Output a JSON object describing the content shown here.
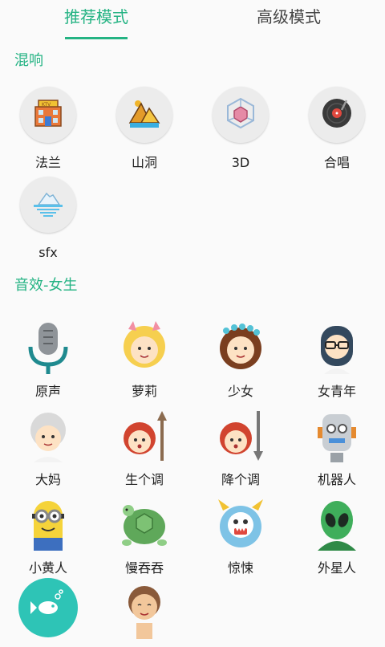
{
  "tabs": {
    "recommended": "推荐模式",
    "advanced": "高级模式"
  },
  "sections": {
    "mix_title": "混响",
    "female_title": "音效-女生"
  },
  "mix_items": [
    {
      "label": "法兰",
      "icon": "ktv-building-icon"
    },
    {
      "label": "山洞",
      "icon": "mountain-cave-icon"
    },
    {
      "label": "3D",
      "icon": "3d-cube-icon"
    },
    {
      "label": "合唱",
      "icon": "vinyl-record-icon"
    },
    {
      "label": "sfx",
      "icon": "iceberg-icon"
    }
  ],
  "female_items": [
    {
      "label": "原声",
      "icon": "microphone-icon"
    },
    {
      "label": "萝莉",
      "icon": "loli-girl-icon"
    },
    {
      "label": "少女",
      "icon": "young-girl-icon"
    },
    {
      "label": "女青年",
      "icon": "young-woman-icon"
    },
    {
      "label": "大妈",
      "icon": "old-woman-icon"
    },
    {
      "label": "生个调",
      "icon": "pitch-up-girl-icon"
    },
    {
      "label": "降个调",
      "icon": "pitch-down-girl-icon"
    },
    {
      "label": "机器人",
      "icon": "robot-icon"
    },
    {
      "label": "小黄人",
      "icon": "minion-icon"
    },
    {
      "label": "慢吞吞",
      "icon": "turtle-icon"
    },
    {
      "label": "惊悚",
      "icon": "monster-icon"
    },
    {
      "label": "外星人",
      "icon": "alien-icon"
    },
    {
      "label": "",
      "icon": "fish-icon"
    },
    {
      "label": "",
      "icon": "tribal-face-icon"
    }
  ],
  "colors": {
    "accent": "#24b383",
    "circle_bg": "#ececec"
  }
}
